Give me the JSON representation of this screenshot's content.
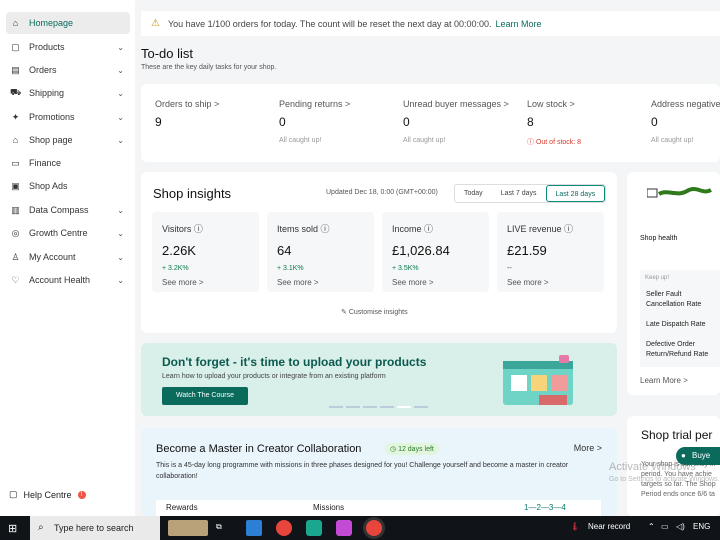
{
  "sidebar": {
    "items": [
      {
        "label": "Homepage",
        "icon": "home-icon",
        "glyph": "⌂"
      },
      {
        "label": "Products",
        "icon": "box-icon",
        "glyph": "▢"
      },
      {
        "label": "Orders",
        "icon": "orders-icon",
        "glyph": "▤"
      },
      {
        "label": "Shipping",
        "icon": "truck-icon",
        "glyph": "⛟"
      },
      {
        "label": "Promotions",
        "icon": "megaphone-icon",
        "glyph": "✦"
      },
      {
        "label": "Shop page",
        "icon": "shop-icon",
        "glyph": "⌂"
      },
      {
        "label": "Finance",
        "icon": "finance-icon",
        "glyph": "▭"
      },
      {
        "label": "Shop Ads",
        "icon": "ads-icon",
        "glyph": "▣"
      },
      {
        "label": "Data Compass",
        "icon": "chart-icon",
        "glyph": "▥"
      },
      {
        "label": "Growth Centre",
        "icon": "growth-icon",
        "glyph": "◎"
      },
      {
        "label": "My Account",
        "icon": "user-icon",
        "glyph": "♙"
      },
      {
        "label": "Account Health",
        "icon": "health-icon",
        "glyph": "♡"
      }
    ],
    "help": "Help Centre",
    "help_badge": "!"
  },
  "banner": {
    "text": "You have 1/100 orders for today. The count will be reset the next day at 00:00:00.",
    "link": "Learn More"
  },
  "todo": {
    "title": "To-do list",
    "subtitle": "These are the key daily tasks for your shop.",
    "metrics": [
      {
        "label": "Orders to ship >",
        "value": "9",
        "note": ""
      },
      {
        "label": "Pending returns >",
        "value": "0",
        "note": "All caught up!"
      },
      {
        "label": "Unread buyer messages >",
        "value": "0",
        "note": "All caught up!"
      },
      {
        "label": "Low stock >",
        "value": "8",
        "note": "ⓘ Out of stock: 8"
      },
      {
        "label": "Address negative",
        "value": "0",
        "note": "All caught up!"
      }
    ]
  },
  "insights": {
    "title": "Shop insights",
    "updated": "Updated Dec 18, 0:00 (GMT+00:00)",
    "ranges": [
      "Today",
      "Last 7 days",
      "Last 28 days"
    ],
    "selected_range": "Last 28 days",
    "cards": [
      {
        "label": "Visitors ⓘ",
        "value": "2.26K",
        "change": "+ 3.2K%",
        "more": "See more >"
      },
      {
        "label": "Items sold ⓘ",
        "value": "64",
        "change": "+ 3.1K%",
        "more": "See more >"
      },
      {
        "label": "Income ⓘ",
        "value": "£1,026.84",
        "change": "+ 3.5K%",
        "more": "See more >"
      },
      {
        "label": "LIVE revenue ⓘ",
        "value": "£21.59",
        "change": "--",
        "more": "See more >"
      }
    ],
    "customise": "Customise insights"
  },
  "promo": {
    "heading": "Don't forget - it's time to upload your products",
    "text": "Learn how to upload your products or integrate from an existing platform",
    "button": "Watch The Course"
  },
  "master": {
    "heading": "Become a Master in Creator Collaboration",
    "tag": "12 days left",
    "more": "More >",
    "description": "This is a 45-day long programme with missions in three phases designed for you! Challenge yourself and become a master in creator collaboration!",
    "tab_rewards": "Rewards",
    "tab_missions": "Missions",
    "steps": "1—2—3—4"
  },
  "right_health": {
    "title": "Shop health",
    "keep_up": "Keep up!",
    "rows": [
      "Seller Fault Cancellation Rate",
      "Late Dispatch Rate",
      "Defective Order Return/Refund Rate"
    ],
    "learn_more": "Learn More >"
  },
  "right_trial": {
    "heading": "Shop trial per",
    "lines": [
      "Your shop is currently in",
      "period. You have achie",
      "targets so far. The Shop",
      "Period ends once 6/6 ta"
    ]
  },
  "buyer_chat": "Buye",
  "watermark": {
    "line1": "Activate Windows",
    "line2": "Go to Settings to activate Windows."
  },
  "taskbar": {
    "search_placeholder": "Type here to search",
    "weather": "Near record",
    "language": "ENG"
  },
  "colors": {
    "accent": "#0a6b5d",
    "warning": "#c59200",
    "negative": "#d4382c",
    "positive": "#0a7a4a"
  }
}
